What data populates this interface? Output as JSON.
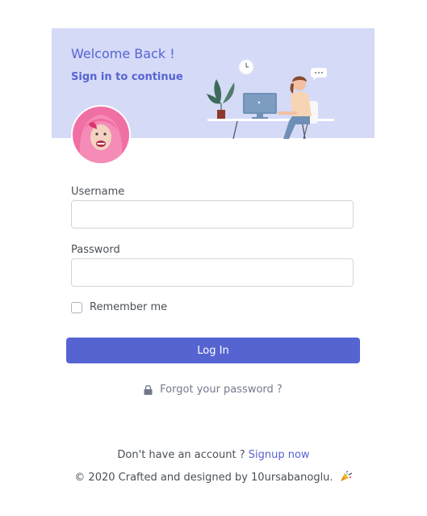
{
  "header": {
    "welcome": "Welcome Back !",
    "subtitle": "Sign in to continue"
  },
  "form": {
    "username_label": "Username",
    "username_value": "",
    "password_label": "Password",
    "password_value": "",
    "remember_label": "Remember me",
    "remember_checked": false,
    "login_label": "Log In",
    "forgot_label": "Forgot your password ?"
  },
  "footer": {
    "signup_prompt": "Don't have an account ?",
    "signup_link": "Signup now",
    "copyright": "© 2020 Crafted and designed by 10ursabanoglu."
  },
  "icons": {
    "lock": "lock-icon",
    "party": "party-popper-icon"
  },
  "colors": {
    "primary": "#5664d2",
    "banner": "#d5daf7"
  }
}
